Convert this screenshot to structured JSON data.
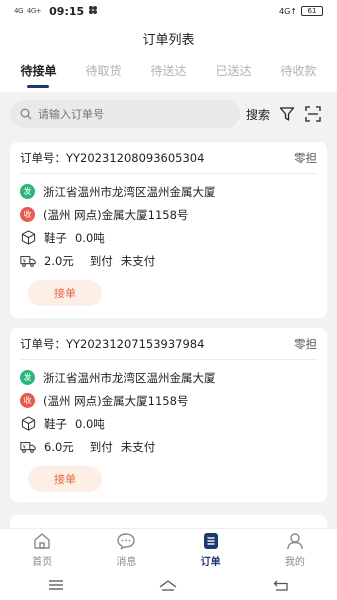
{
  "status_bar": {
    "signal_1": "4G",
    "signal_2": "4G+",
    "time": "09:15",
    "network": "4G↑",
    "battery": "61"
  },
  "header": {
    "title": "订单列表"
  },
  "tabs": [
    {
      "label": "待接单",
      "active": true
    },
    {
      "label": "待取货",
      "active": false
    },
    {
      "label": "待送达",
      "active": false
    },
    {
      "label": "已送达",
      "active": false
    },
    {
      "label": "待收款",
      "active": false
    }
  ],
  "search": {
    "placeholder": "请输入订单号",
    "button": "搜索"
  },
  "orders": [
    {
      "order_no": "订单号：YY20231208093605304",
      "type": "零担",
      "send_badge": "发",
      "send_addr": "浙江省温州市龙湾区温州金属大厦",
      "recv_badge": "收",
      "recv_addr": "(温州 网点)金属大厦1158号",
      "goods": "鞋子",
      "weight": "0.0吨",
      "price": "2.0元",
      "pay_mode": "到付",
      "pay_status": "未支付",
      "action": "接单"
    },
    {
      "order_no": "订单号：YY20231207153937984",
      "type": "零担",
      "send_badge": "发",
      "send_addr": "浙江省温州市龙湾区温州金属大厦",
      "recv_badge": "收",
      "recv_addr": "(温州 网点)金属大厦1158号",
      "goods": "鞋子",
      "weight": "0.0吨",
      "price": "6.0元",
      "pay_mode": "到付",
      "pay_status": "未支付",
      "action": "接单"
    }
  ],
  "bottom_nav": [
    {
      "label": "首页",
      "icon": "home-icon",
      "active": false
    },
    {
      "label": "消息",
      "icon": "message-icon",
      "active": false
    },
    {
      "label": "订单",
      "icon": "order-icon",
      "active": true
    },
    {
      "label": "我的",
      "icon": "profile-icon",
      "active": false
    }
  ],
  "colors": {
    "accent": "#1c3a6e",
    "send": "#2bb57a",
    "recv": "#e65a4f",
    "action_bg": "#fdeee6",
    "action_text": "#e2674a"
  }
}
